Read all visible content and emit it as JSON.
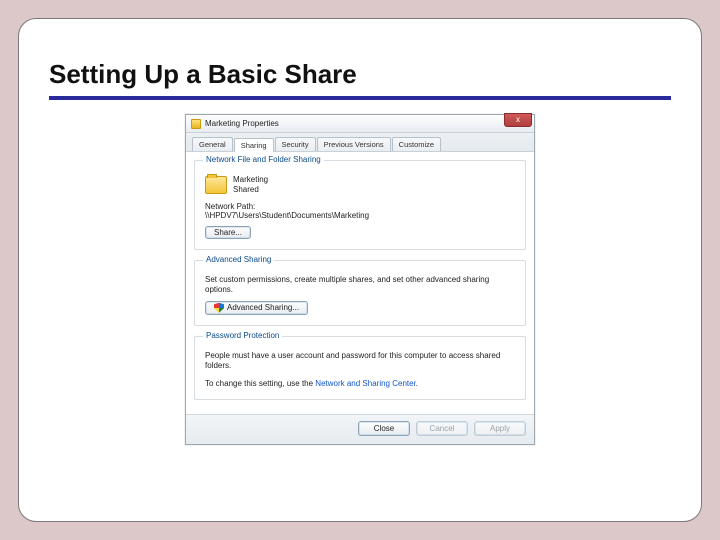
{
  "slide": {
    "title": "Setting Up a Basic Share"
  },
  "dialog": {
    "title": "Marketing Properties",
    "close_label": "x",
    "tabs": [
      {
        "label": "General"
      },
      {
        "label": "Sharing"
      },
      {
        "label": "Security"
      },
      {
        "label": "Previous Versions"
      },
      {
        "label": "Customize"
      }
    ],
    "nfs": {
      "group_title": "Network File and Folder Sharing",
      "folder_name": "Marketing",
      "share_state": "Shared",
      "path_label": "Network Path:",
      "path_value": "\\\\HPDV7\\Users\\Student\\Documents\\Marketing",
      "share_btn": "Share..."
    },
    "adv": {
      "group_title": "Advanced Sharing",
      "desc": "Set custom permissions, create multiple shares, and set other advanced sharing options.",
      "btn": "Advanced Sharing..."
    },
    "pwd": {
      "group_title": "Password Protection",
      "desc": "People must have a user account and password for this computer to access shared folders.",
      "change_prefix": "To change this setting, use the ",
      "link": "Network and Sharing Center",
      "change_suffix": "."
    },
    "footer": {
      "close": "Close",
      "cancel": "Cancel",
      "apply": "Apply"
    }
  }
}
